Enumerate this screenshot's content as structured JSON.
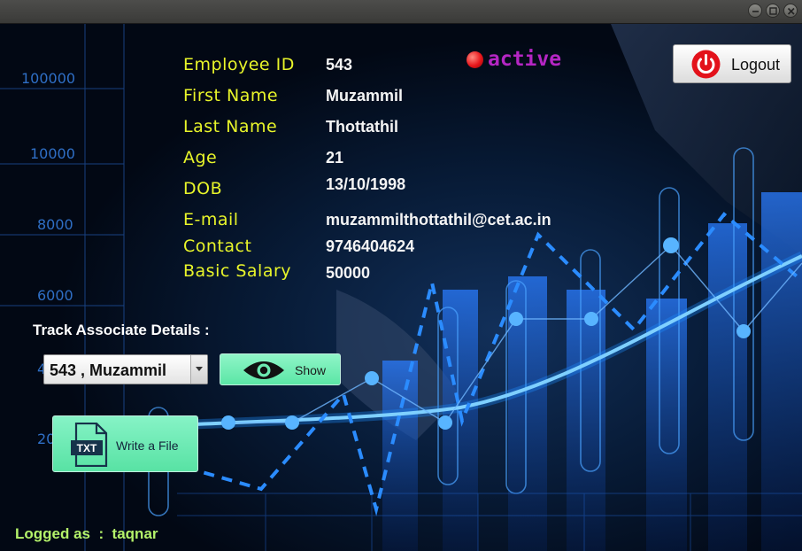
{
  "window": {
    "controls": [
      "minimize-icon",
      "maximize-icon",
      "close-icon"
    ]
  },
  "background": {
    "axis_ticks": [
      "100000",
      "10000",
      "8000",
      "6000",
      "4",
      "20"
    ]
  },
  "employee": {
    "fields": [
      {
        "label": "Employee ID",
        "value": "543"
      },
      {
        "label": "First Name",
        "value": "Muzammil"
      },
      {
        "label": "Last Name",
        "value": "Thottathil"
      },
      {
        "label": "Age",
        "value": "21"
      },
      {
        "label": "DOB",
        "value": "13/10/1998"
      },
      {
        "label": "E-mail",
        "value": "muzammilthottathil@cet.ac.in"
      },
      {
        "label": "Contact",
        "value": "9746404624"
      },
      {
        "label": "Basic Salary",
        "value": "50000"
      }
    ]
  },
  "status": {
    "text": "active",
    "color": "#b526c4",
    "dot_color": "#e8161b"
  },
  "logout": {
    "label": "Logout",
    "icon": "power-icon"
  },
  "track": {
    "label": "Track Associate Details :",
    "selected": "543 , Muzammil",
    "show_label": "Show",
    "show_icon": "eye-icon"
  },
  "file": {
    "label": "Write a File",
    "icon_text": "TXT",
    "icon": "txt-file-icon"
  },
  "footer": {
    "logged_text": "Logged as  :  taqnar"
  },
  "colors": {
    "accent_green": "#5be6a6",
    "label_yellow": "#e8f52a",
    "footer_green": "#b4f26a"
  }
}
